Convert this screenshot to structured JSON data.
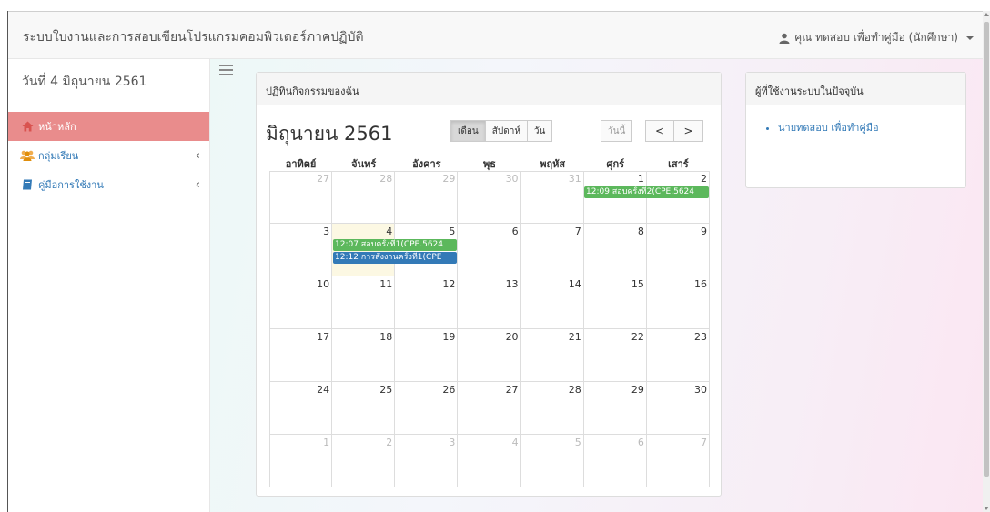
{
  "header": {
    "brand": "ระบบใบงานและการสอบเขียนโปรแกรมคอมพิวเตอร์ภาคปฏิบัติ",
    "user_name": "คุณ ทดสอบ เพื่อทำคู่มือ (นักศึกษา)"
  },
  "sidebar": {
    "date": "วันที่ 4 มิถุนายน 2561",
    "items": [
      {
        "label": "หน้าหลัก"
      },
      {
        "label": "กลุ่มเรียน"
      },
      {
        "label": "คู่มือการใช้งาน"
      }
    ]
  },
  "calendar_panel": {
    "heading": "ปฏิทินกิจกรรมของฉัน",
    "month_title": "มิถุนายน 2561",
    "view_month": "เดือน",
    "view_week": "สัปดาห์",
    "view_day": "วัน",
    "today": "วันนี้",
    "prev": "<",
    "next": ">",
    "days_of_week": [
      "อาทิตย์",
      "จันทร์",
      "อังคาร",
      "พุธ",
      "พฤหัส",
      "ศุกร์",
      "เสาร์"
    ],
    "weeks": [
      [
        "27",
        "28",
        "29",
        "30",
        "31",
        "1",
        "2"
      ],
      [
        "3",
        "4",
        "5",
        "6",
        "7",
        "8",
        "9"
      ],
      [
        "10",
        "11",
        "12",
        "13",
        "14",
        "15",
        "16"
      ],
      [
        "17",
        "18",
        "19",
        "20",
        "21",
        "22",
        "23"
      ],
      [
        "24",
        "25",
        "26",
        "27",
        "28",
        "29",
        "30"
      ],
      [
        "1",
        "2",
        "3",
        "4",
        "5",
        "6",
        "7"
      ]
    ],
    "events": [
      {
        "text": "12:09 สอบครั้งที่2(CPE.5624",
        "color": "#5cb85c"
      },
      {
        "text": "12:07 สอบครั้งที่1(CPE.5624",
        "color": "#5cb85c"
      },
      {
        "text": "12:12 การสั่งงานครั้งที่1(CPE",
        "color": "#337ab7"
      }
    ]
  },
  "online_panel": {
    "heading": "ผู้ที่ใช้งานระบบในปัจจุบัน",
    "users": [
      "นายทดสอบ เพื่อทำคู่มือ"
    ]
  },
  "colors": {
    "active_nav": "#e98c8c",
    "today_cell": "#fcf8e3",
    "link": "#337ab7"
  }
}
